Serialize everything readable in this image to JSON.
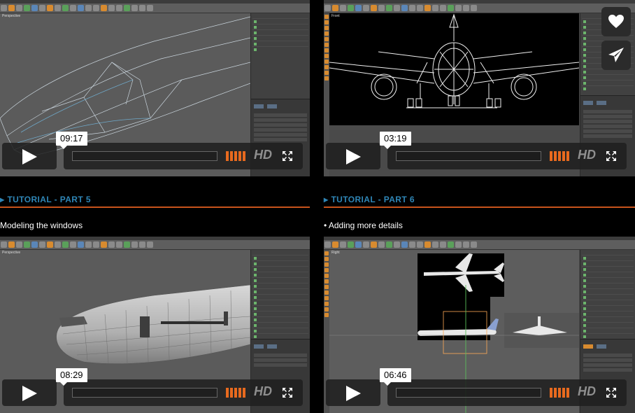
{
  "videos": [
    {
      "id": "part-4-video",
      "duration": "09:17",
      "viewport_label": "Perspective",
      "hd_label": "HD"
    },
    {
      "id": "part-5-preview-video",
      "duration": "03:19",
      "viewport_label": "Front",
      "hd_label": "HD"
    },
    {
      "id": "part-5-video",
      "duration": "08:29",
      "viewport_label": "Perspective",
      "hd_label": "HD"
    },
    {
      "id": "part-6-video",
      "duration": "06:46",
      "viewport_label": "Right",
      "hd_label": "HD"
    }
  ],
  "sections": [
    {
      "title": "TUTORIAL - PART 5",
      "description": "Modeling the windows"
    },
    {
      "title": "TUTORIAL - PART 6",
      "description": "• Adding more details"
    }
  ],
  "side_actions": {
    "like": "heart-icon",
    "share": "send-icon"
  },
  "colors": {
    "accent_blue": "#2f86b6",
    "accent_orange": "#c8531c",
    "volume_orange": "#e86a1e"
  }
}
